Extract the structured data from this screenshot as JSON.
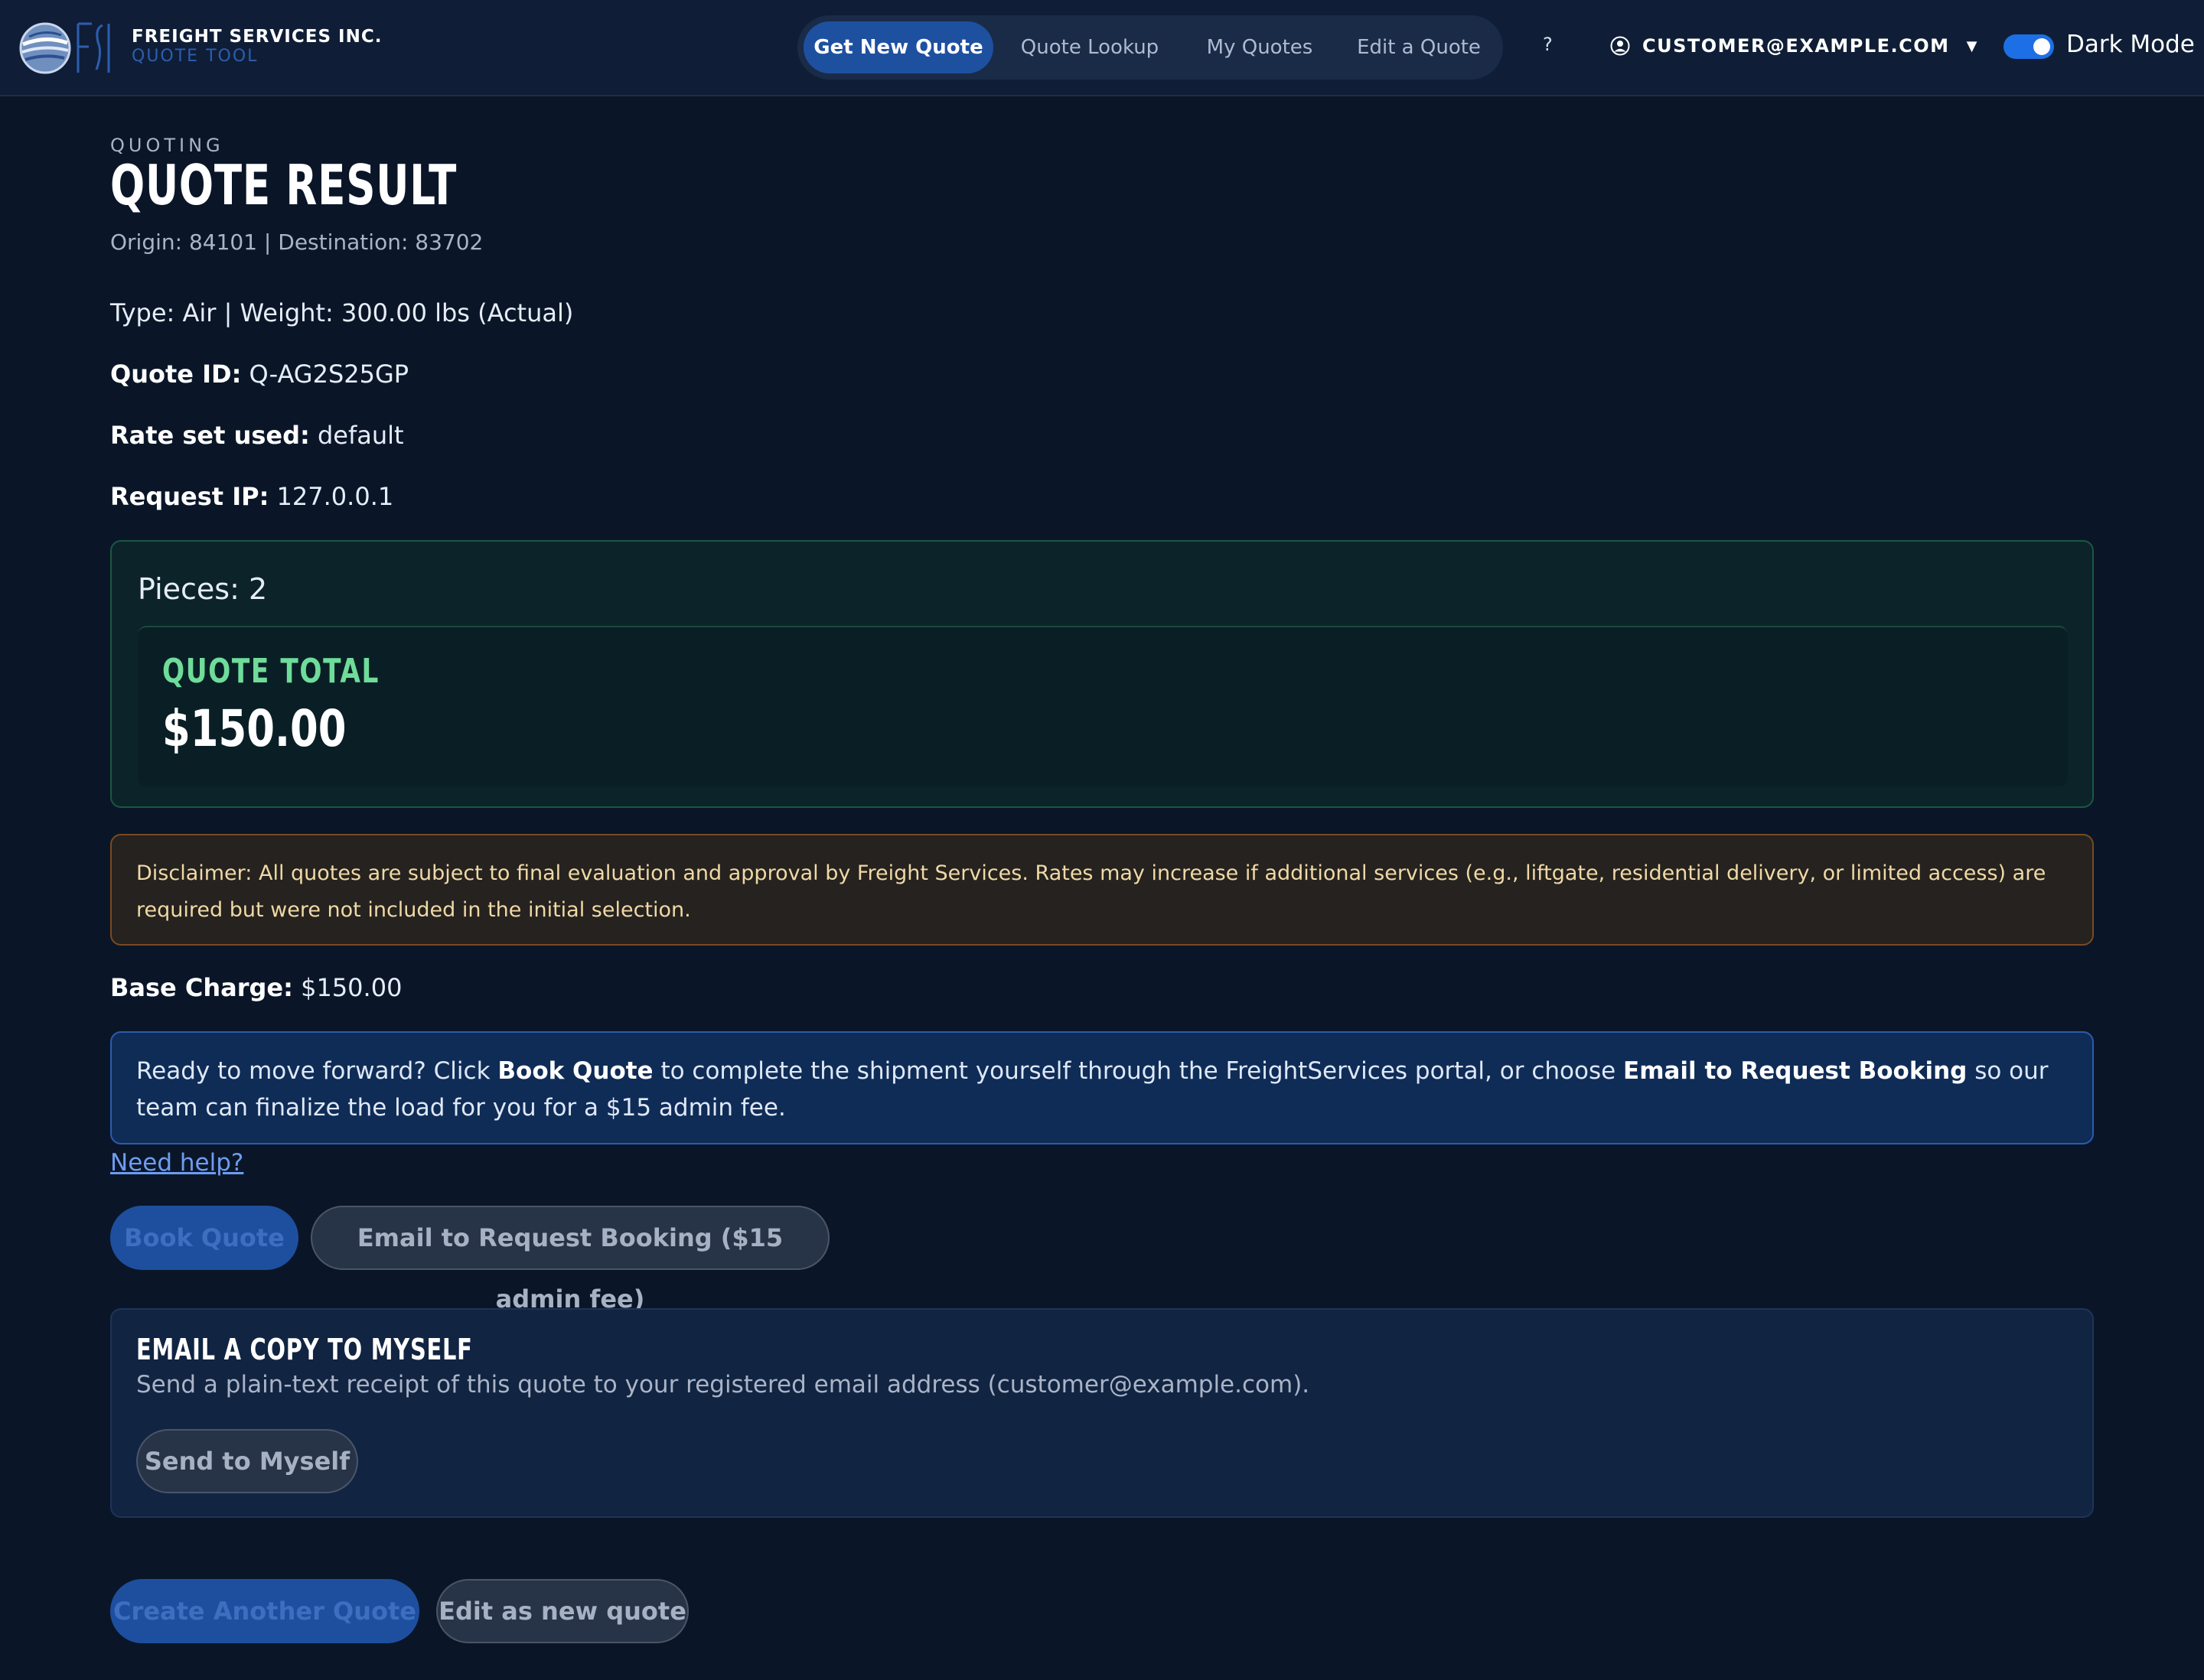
{
  "header": {
    "brand_name": "FREIGHT SERVICES INC.",
    "brand_sub": "QUOTE TOOL",
    "nav": [
      {
        "label": "Get New Quote",
        "active": true
      },
      {
        "label": "Quote Lookup",
        "active": false
      },
      {
        "label": "My Quotes",
        "active": false
      },
      {
        "label": "Edit a Quote",
        "active": false
      }
    ],
    "help_label": "?",
    "user_email": "CUSTOMER@EXAMPLE.COM",
    "dark_mode_label": "Dark Mode",
    "dark_mode_on": true
  },
  "page": {
    "eyebrow": "QUOTING",
    "title": "QUOTE RESULT",
    "route": "Origin: 84101 | Destination: 83702",
    "type_weight": "Type: Air | Weight: 300.00 lbs (Actual)",
    "quote_id_label": "Quote ID:",
    "quote_id": "Q-AG2S25GP",
    "rate_set_label": "Rate set used:",
    "rate_set": "default",
    "request_ip_label": "Request IP:",
    "request_ip": "127.0.0.1"
  },
  "summary": {
    "pieces": "Pieces: 2",
    "total_label": "QUOTE TOTAL",
    "total_value": "$150.00"
  },
  "disclaimer": "Disclaimer: All quotes are subject to final evaluation and approval by Freight Services. Rates may increase if additional services (e.g., liftgate, residential delivery, or limited access) are required but were not included in the initial selection.",
  "base_charge_label": "Base Charge:",
  "base_charge": "$150.00",
  "ready": {
    "text_1": "Ready to move forward? Click ",
    "bold_1": "Book Quote",
    "text_2": " to complete the shipment yourself through the FreightServices portal, or choose ",
    "bold_2": "Email to Request Booking",
    "text_3": " so our team can finalize the load for you for a $15 admin fee."
  },
  "need_help": "Need help?",
  "actions": {
    "book_quote": "Book Quote",
    "email_request": "Email to Request Booking ($15 admin fee)"
  },
  "email_copy": {
    "title": "EMAIL A COPY TO MYSELF",
    "description": "Send a plain-text receipt of this quote to your registered email address (customer@example.com).",
    "button": "Send to Myself"
  },
  "footer_actions": {
    "create_another": "Create Another Quote",
    "edit_new": "Edit as new quote"
  },
  "colors": {
    "background": "#0a1628",
    "accent": "#1e50a0",
    "success": "#6fdc9a",
    "warning_text": "#f0d9a6"
  },
  "icons": [
    "globe-logo-icon",
    "fsi-monogram-icon",
    "user-circle-icon",
    "chevron-down-icon"
  ]
}
